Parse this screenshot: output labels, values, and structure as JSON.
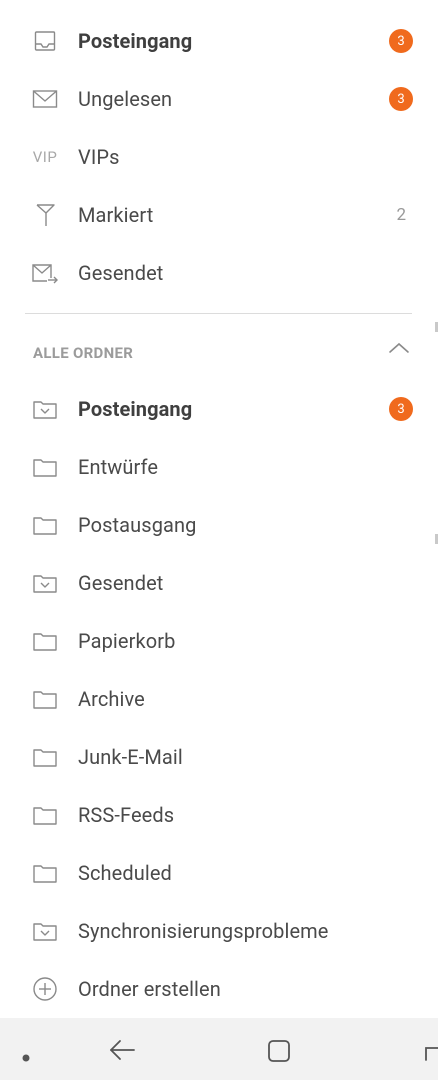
{
  "favorites": [
    {
      "label": "Posteingang",
      "icon": "inbox-icon",
      "badge": "3",
      "bold": true
    },
    {
      "label": "Ungelesen",
      "icon": "unread-envelope-icon",
      "badge": "3"
    },
    {
      "label": "VIPs",
      "icon": "vip-icon",
      "icon_text": "VIP"
    },
    {
      "label": "Markiert",
      "icon": "flag-icon",
      "count": "2"
    },
    {
      "label": "Gesendet",
      "icon": "sent-envelope-icon"
    }
  ],
  "folders_section": {
    "title": "ALLE ORDNER",
    "collapse_icon": "chevron-up-icon"
  },
  "folders": [
    {
      "label": "Posteingang",
      "icon": "folder-inbox-icon",
      "badge": "3",
      "bold": true
    },
    {
      "label": "Entwürfe",
      "icon": "folder-icon"
    },
    {
      "label": "Postausgang",
      "icon": "folder-icon"
    },
    {
      "label": "Gesendet",
      "icon": "folder-inbox-icon"
    },
    {
      "label": "Papierkorb",
      "icon": "folder-icon"
    },
    {
      "label": "Archive",
      "icon": "folder-icon"
    },
    {
      "label": "Junk-E-Mail",
      "icon": "folder-icon"
    },
    {
      "label": "RSS-Feeds",
      "icon": "folder-icon"
    },
    {
      "label": "Scheduled",
      "icon": "folder-icon"
    },
    {
      "label": "Synchronisierungsprobleme",
      "icon": "folder-inbox-icon"
    }
  ],
  "create_folder": {
    "label": "Ordner erstellen",
    "icon": "plus-circle-icon"
  },
  "navbar": {
    "items": [
      "dot-icon",
      "back-arrow-icon",
      "home-square-icon",
      "recents-icon"
    ]
  },
  "colors": {
    "badge": "#f06a1d",
    "text": "#4a4a4a",
    "icon": "#8a8a8a",
    "divider": "#dcdcdc",
    "navbar_bg": "#f2f2f2"
  }
}
